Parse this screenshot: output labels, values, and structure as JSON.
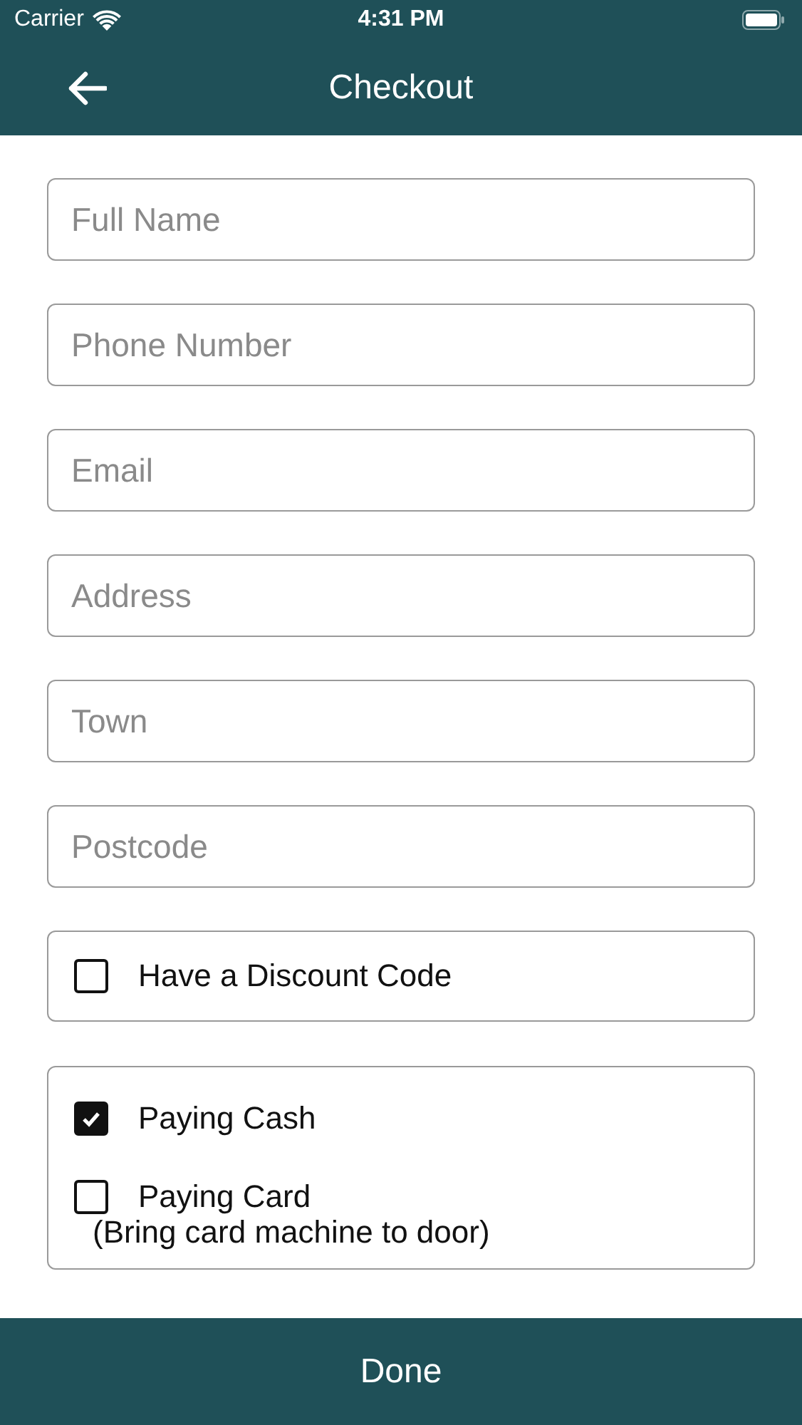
{
  "status_bar": {
    "carrier": "Carrier",
    "time": "4:31 PM"
  },
  "header": {
    "title": "Checkout"
  },
  "fields": [
    {
      "placeholder": "Full Name"
    },
    {
      "placeholder": "Phone Number"
    },
    {
      "placeholder": "Email"
    },
    {
      "placeholder": "Address"
    },
    {
      "placeholder": "Town"
    },
    {
      "placeholder": "Postcode"
    }
  ],
  "discount": {
    "label": "Have a Discount Code",
    "checked": false
  },
  "payment_options": [
    {
      "label": "Paying Cash",
      "checked": true
    },
    {
      "label": "Paying Card",
      "note": "(Bring card machine to door)",
      "checked": false
    }
  ],
  "done_button": {
    "label": "Done"
  }
}
